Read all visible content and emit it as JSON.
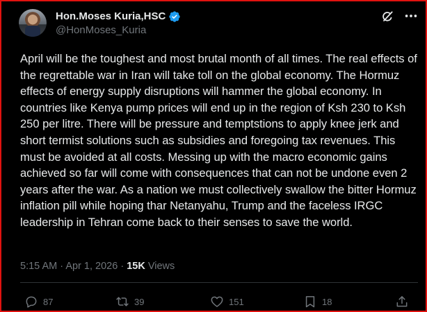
{
  "author": {
    "display_name": "Hon.Moses Kuria,HSC",
    "handle": "@HonMoses_Kuria",
    "verified_icon": "verified-badge",
    "avatar": "profile-photo"
  },
  "post": {
    "text": "April will be the toughest and most brutal month of all times. The real effects of the regrettable war in Iran will take toll on the global economy. The Hormuz effects of energy supply disruptions will hammer the global economy. In countries like Kenya pump prices will end up in the region of Ksh 230 to Ksh 250 per litre. There will be pressure and temptstions to apply knee jerk and short termist solutions such as subsidies and foregoing tax revenues. This must be avoided at all costs. Messing up with the macro economic gains achieved so far will come with consequences that can not be undone even 2 years after the war. As a nation we must collectively swallow the bitter Hormuz inflation pill while hoping thar Netanyahu, Trump and the faceless IRGC leadership in Tehran come back to their senses to save the world.",
    "time": "5:15 AM",
    "separator": "·",
    "date": "Apr 1, 2026",
    "views_count": "15K",
    "views_label": "Views"
  },
  "actions": {
    "replies": "87",
    "reposts": "39",
    "likes": "151",
    "bookmarks": "18"
  },
  "colors": {
    "background": "#000000",
    "text": "#e7e9ea",
    "secondary": "#71767b",
    "verified": "#1d9bf0",
    "frame": "#e0120f"
  }
}
